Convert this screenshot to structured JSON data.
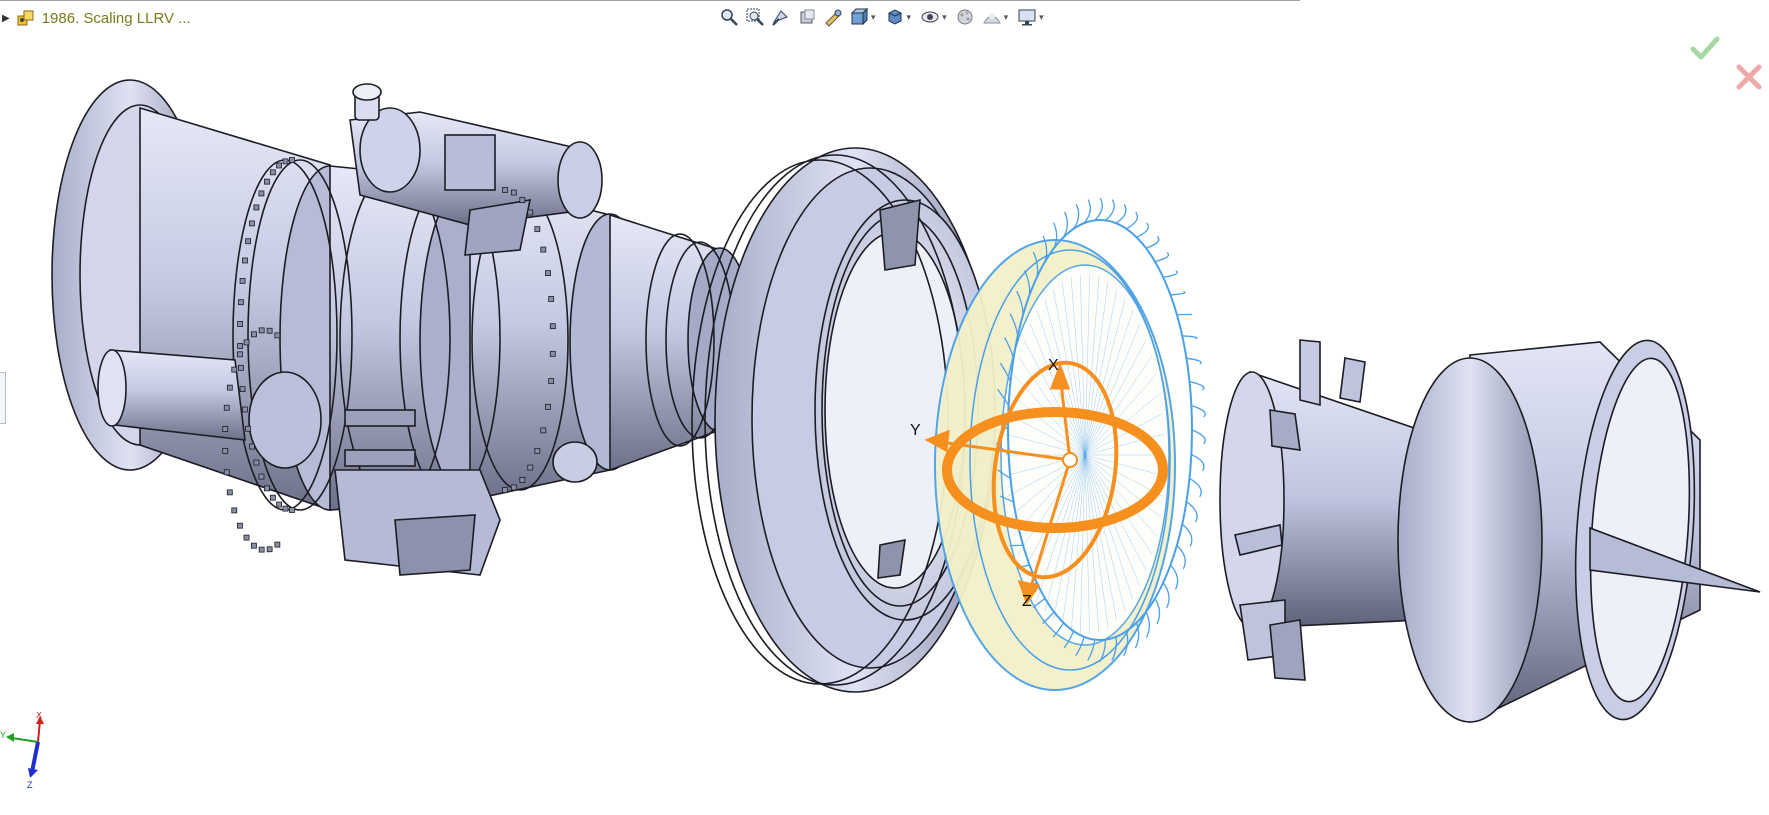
{
  "window": {
    "tree_title": "1986.  Scaling LLRV ..."
  },
  "heads_up_toolbar": {
    "tools": [
      {
        "name": "zoom-to-fit-icon",
        "has_dropdown": false
      },
      {
        "name": "zoom-to-area-icon",
        "has_dropdown": false
      },
      {
        "name": "previous-view-icon",
        "has_dropdown": false
      },
      {
        "name": "section-view-icon",
        "has_dropdown": false
      },
      {
        "name": "dynamic-annotation-views-icon",
        "has_dropdown": false
      },
      {
        "name": "view-orientation-icon",
        "has_dropdown": true
      },
      {
        "name": "display-style-icon",
        "has_dropdown": true
      },
      {
        "name": "hide-show-items-icon",
        "has_dropdown": true
      },
      {
        "name": "edit-appearance-icon",
        "has_dropdown": false
      },
      {
        "name": "apply-scene-icon",
        "has_dropdown": true
      },
      {
        "name": "view-settings-icon",
        "has_dropdown": true
      }
    ],
    "dropdown_glyph": "▾"
  },
  "confirmation_corner": {
    "accept_color": "#7ac27a",
    "cancel_color": "#e89090"
  },
  "triad_gizmo": {
    "axes": [
      "X",
      "Y",
      "Z"
    ],
    "ring_color": "#f5901e"
  },
  "reference_triad": {
    "axes": [
      "X",
      "Y",
      "Z"
    ],
    "x_color": "#d02020",
    "y_color": "#20a020",
    "z_color": "#2030d0"
  },
  "model": {
    "part_color": "#c3c8e2",
    "selected_color": "#4aa0e8",
    "selected_fill": "#f3f1c9"
  }
}
